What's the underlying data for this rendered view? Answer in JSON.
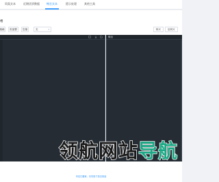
{
  "nav": {
    "tabs": [
      {
        "label": "同类文本"
      },
      {
        "label": "近期优质数据"
      },
      {
        "label": "畅言文本"
      },
      {
        "label": "提示处理"
      },
      {
        "label": "其他工具"
      }
    ]
  },
  "toolbar": {
    "section_title": "格",
    "buttons": [
      {
        "label": "缩格"
      },
      {
        "label": "批量替"
      },
      {
        "label": "压缩"
      }
    ],
    "select_value": "无",
    "right_buttons": [
      {
        "label": "转义"
      },
      {
        "label": "反转义"
      }
    ]
  },
  "editor_left": {
    "title": ""
  },
  "editor_right": {
    "title": "输出"
  },
  "footer": {
    "note": "本站已备案，请勿用于违法用途"
  },
  "watermark": {
    "prefix": "领航网站",
    "highlight": "导航"
  },
  "colors": {
    "accent": "#409eff",
    "editor_bg": "#252c33",
    "watermark_green": "#1ba784"
  }
}
